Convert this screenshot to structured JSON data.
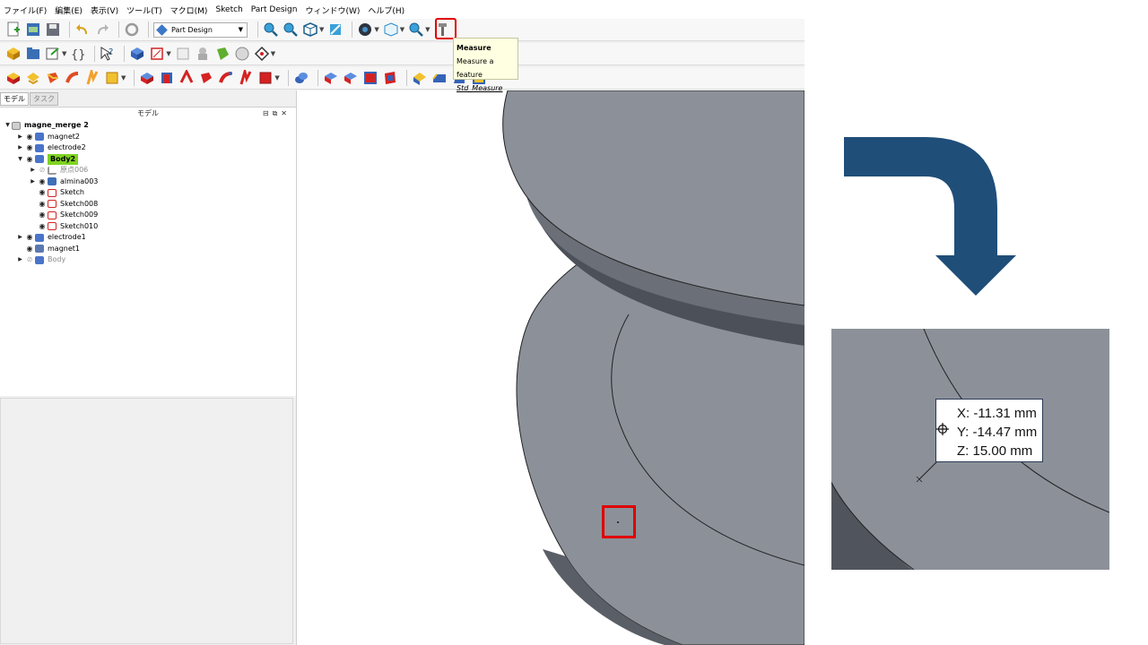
{
  "menu": [
    "ファイル(F)",
    "編集(E)",
    "表示(V)",
    "ツール(T)",
    "マクロ(M)",
    "Sketch",
    "Part Design",
    "ウィンドウ(W)",
    "ヘルプ(H)"
  ],
  "toolbar": {
    "workbench": "Part Design",
    "tooltip": {
      "title": "Measure",
      "desc": "Measure a feature",
      "cmd": "Std_Measure"
    }
  },
  "panel": {
    "tabs": [
      "モデル",
      "タスク"
    ],
    "header": "モデル",
    "tree": [
      {
        "label": "magne_merge 2",
        "level": 0,
        "arrow": "▼",
        "eye": false,
        "icon": "file",
        "bold": true
      },
      {
        "label": "magnet2",
        "level": 1,
        "arrow": "▶",
        "eye": true,
        "icon": "body"
      },
      {
        "label": "electrode2",
        "level": 1,
        "arrow": "▶",
        "eye": true,
        "icon": "body"
      },
      {
        "label": "Body2",
        "level": 1,
        "arrow": "▼",
        "eye": true,
        "icon": "body",
        "active": true
      },
      {
        "label": "原点006",
        "level": 2,
        "arrow": "▶",
        "eye": "hidden",
        "icon": "origin",
        "dim": true
      },
      {
        "label": "almina003",
        "level": 2,
        "arrow": "▶",
        "eye": true,
        "icon": "feat"
      },
      {
        "label": "Sketch",
        "level": 2,
        "arrow": "",
        "eye": true,
        "icon": "sketch"
      },
      {
        "label": "Sketch008",
        "level": 2,
        "arrow": "",
        "eye": true,
        "icon": "sketch"
      },
      {
        "label": "Sketch009",
        "level": 2,
        "arrow": "",
        "eye": true,
        "icon": "sketch"
      },
      {
        "label": "Sketch010",
        "level": 2,
        "arrow": "",
        "eye": true,
        "icon": "sketch"
      },
      {
        "label": "electrode1",
        "level": 1,
        "arrow": "▶",
        "eye": true,
        "icon": "body"
      },
      {
        "label": "magnet1",
        "level": 1,
        "arrow": "",
        "eye": true,
        "icon": "magnet"
      },
      {
        "label": "Body",
        "level": 1,
        "arrow": "▶",
        "eye": "hidden",
        "icon": "body",
        "dim": true
      }
    ]
  },
  "coords": {
    "x": "X: -11.31 mm",
    "y": "Y: -14.47 mm",
    "z": "Z: 15.00 mm"
  },
  "colors": {
    "accent_red": "#e00000",
    "arrow_blue": "#1f4e79",
    "model_gray": "#8c9199",
    "active_green": "#7ed321"
  }
}
